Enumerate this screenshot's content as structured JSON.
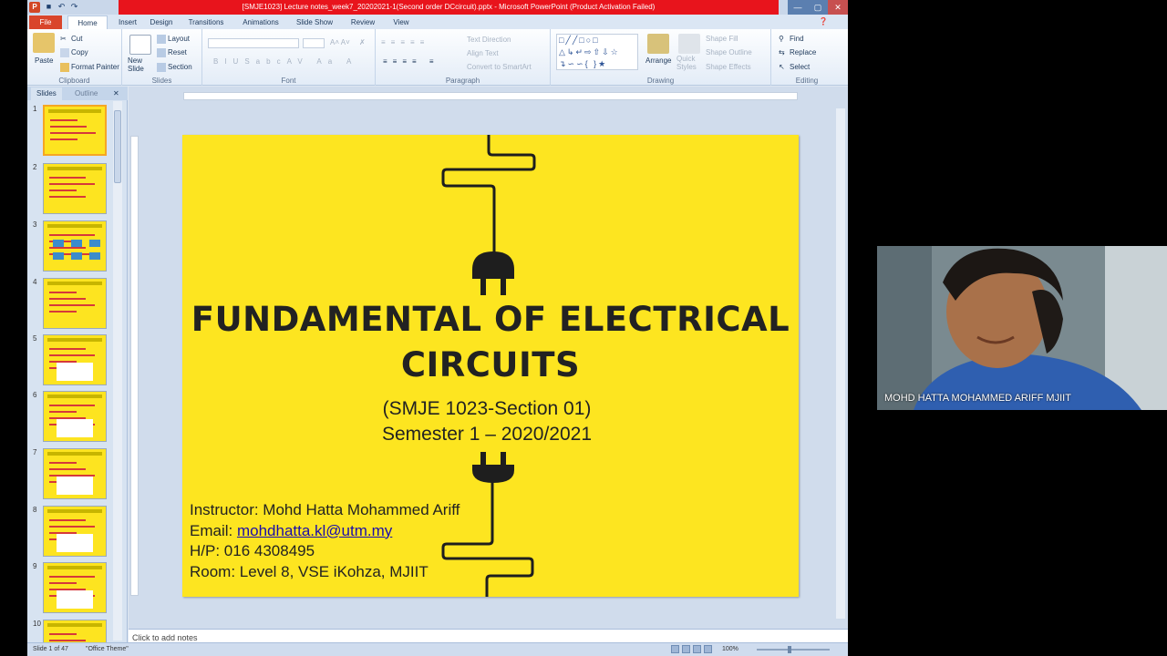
{
  "window": {
    "title": "[SMJE1023] Lecture notes_week7_20202021-1(Second order DCcircuit).pptx - Microsoft PowerPoint (Product Activation Failed)"
  },
  "ribbon_tabs": [
    "File",
    "Home",
    "Insert",
    "Design",
    "Transitions",
    "Animations",
    "Slide Show",
    "Review",
    "View"
  ],
  "ribbon": {
    "clipboard": {
      "paste": "Paste",
      "cut": "Cut",
      "copy": "Copy",
      "format_painter": "Format Painter",
      "label": "Clipboard"
    },
    "slides": {
      "new_slide": "New Slide",
      "layout": "Layout",
      "reset": "Reset",
      "section": "Section",
      "label": "Slides"
    },
    "font": {
      "label": "Font"
    },
    "paragraph": {
      "text_direction": "Text Direction",
      "align_text": "Align Text",
      "convert_smartart": "Convert to SmartArt",
      "label": "Paragraph"
    },
    "drawing": {
      "arrange": "Arrange",
      "quick_styles": "Quick Styles",
      "shape_fill": "Shape Fill",
      "shape_outline": "Shape Outline",
      "shape_effects": "Shape Effects",
      "label": "Drawing"
    },
    "editing": {
      "find": "Find",
      "replace": "Replace",
      "select": "Select",
      "label": "Editing"
    }
  },
  "pane_tabs": {
    "slides": "Slides",
    "outline": "Outline"
  },
  "thumbnails": [
    "1",
    "2",
    "3",
    "4",
    "5",
    "6",
    "7",
    "8",
    "9",
    "10"
  ],
  "selected_slide": 1,
  "slide": {
    "title": "FUNDAMENTAL OF ELECTRICAL CIRCUITS",
    "subtitle_line1": "(SMJE 1023-Section 01)",
    "subtitle_line2": "Semester 1 – 2020/2021",
    "instructor": "Instructor: Mohd Hatta Mohammed Ariff",
    "email_label": "Email: ",
    "email": "mohdhatta.kl@utm.my",
    "phone": "H/P: 016 4308495",
    "room": "Room: Level 8, VSE iKohza, MJIIT"
  },
  "notes_placeholder": "Click to add notes",
  "status": {
    "slide_of": "Slide 1 of 47",
    "theme": "\"Office Theme\"",
    "zoom": "100%"
  },
  "participant": {
    "name": "MOHD HATTA MOHAMMED ARIFF MJIIT"
  },
  "colors": {
    "slide_bg": "#fde520",
    "title_bar": "#e8141c",
    "file_tab": "#d9452b"
  }
}
